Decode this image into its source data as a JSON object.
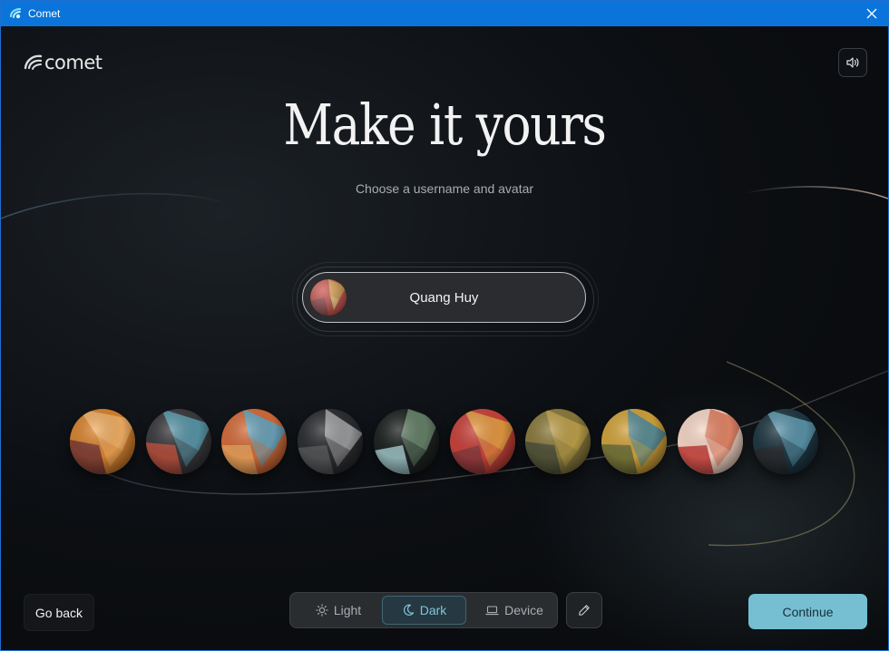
{
  "window": {
    "title": "Comet"
  },
  "logo": {
    "text": "comet"
  },
  "header": {
    "title": "Make it yours",
    "subtitle": "Choose a username and avatar"
  },
  "username": {
    "value": "Quang Huy"
  },
  "icons": {
    "app": "comet-logo-icon",
    "close": "close-icon",
    "sound": "speaker-icon",
    "light": "sun-icon",
    "dark": "moon-icon",
    "device": "laptop-icon",
    "edit": "pencil-icon"
  },
  "avatars": [
    {
      "name": "avatar-1",
      "colors": [
        "#d9832e",
        "#f2b36a",
        "#7a3a36"
      ]
    },
    {
      "name": "avatar-2",
      "colors": [
        "#3b3b3f",
        "#5b9eb0",
        "#b8503d"
      ]
    },
    {
      "name": "avatar-3",
      "colors": [
        "#d36b3a",
        "#5fa7c4",
        "#e7a15a"
      ]
    },
    {
      "name": "avatar-4",
      "colors": [
        "#2d2e31",
        "#a5a6a8",
        "#555659"
      ]
    },
    {
      "name": "avatar-5",
      "colors": [
        "#1e2322",
        "#6b8a6f",
        "#9fc4c8"
      ]
    },
    {
      "name": "avatar-6",
      "colors": [
        "#c8423a",
        "#e6a142",
        "#8a3a3d"
      ]
    },
    {
      "name": "avatar-7",
      "colors": [
        "#8a7a3c",
        "#c0a24a",
        "#4b4f39"
      ]
    },
    {
      "name": "avatar-8",
      "colors": [
        "#d0a23a",
        "#4d8a9c",
        "#6a6e3a"
      ]
    },
    {
      "name": "avatar-9",
      "colors": [
        "#f5d6c6",
        "#e07c5c",
        "#c8403b"
      ]
    },
    {
      "name": "avatar-10",
      "colors": [
        "#1f3844",
        "#5f9cb3",
        "#2a2c30"
      ]
    }
  ],
  "selected_avatar": "avatar-6",
  "footer": {
    "back_label": "Go back",
    "continue_label": "Continue",
    "theme": {
      "options": [
        "Light",
        "Dark",
        "Device"
      ],
      "selected": "Dark"
    }
  },
  "colors": {
    "titlebar": "#0a74da",
    "accent": "#76bfd3",
    "selected_theme_text": "#7fc6da"
  }
}
